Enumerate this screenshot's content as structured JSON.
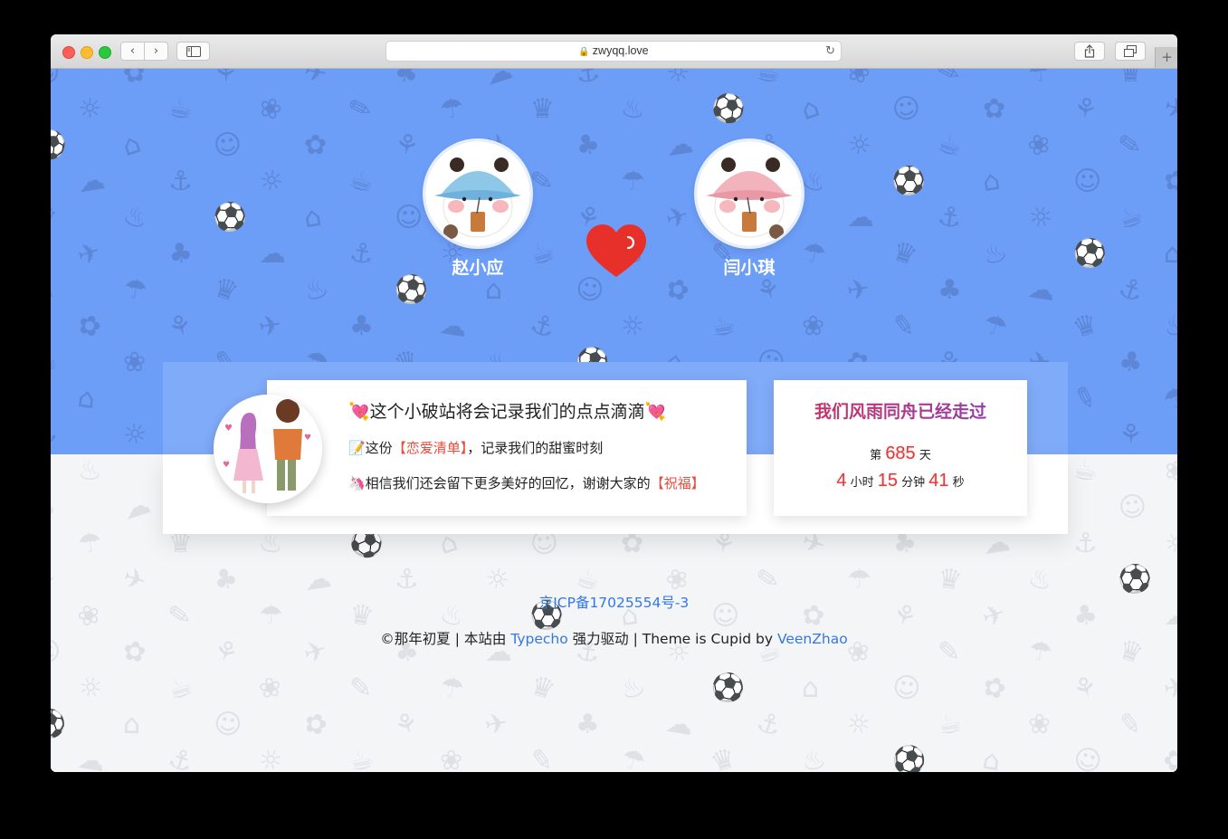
{
  "browser": {
    "url": "zwyqq.love",
    "nav_back": "‹",
    "nav_forward": "›",
    "add_tab": "+"
  },
  "couple": {
    "boy_name": "赵小应",
    "girl_name": "闫小琪"
  },
  "message": {
    "title": "💘这个小破站将会记录我们的点点滴滴💘",
    "line1_prefix": "📝这份",
    "line1_highlight": "【恋爱清单】",
    "line1_suffix": "，记录我们的甜蜜时刻",
    "line2_prefix": "🦄相信我们还会留下更多美好的回忆，谢谢大家的",
    "line2_highlight": "【祝福】"
  },
  "counter": {
    "title": "我们风雨同舟已经走过",
    "day_prefix": "第",
    "days": "685",
    "day_suffix": "天",
    "hours": "4",
    "hours_unit": "小时",
    "minutes": "15",
    "minutes_unit": "分钟",
    "seconds": "41",
    "seconds_unit": "秒"
  },
  "footer": {
    "icp": "京ICP备17025554号-3",
    "copyright_prefix": "©那年初夏 | 本站由 ",
    "typecho_link": "Typecho",
    "middle": " 强力驱动 | Theme is Cupid by ",
    "author_link": "VeenZhao"
  },
  "colors": {
    "hero_bg": "#6c9df7",
    "highlight": "#e74c3c",
    "link": "#3377e6"
  }
}
